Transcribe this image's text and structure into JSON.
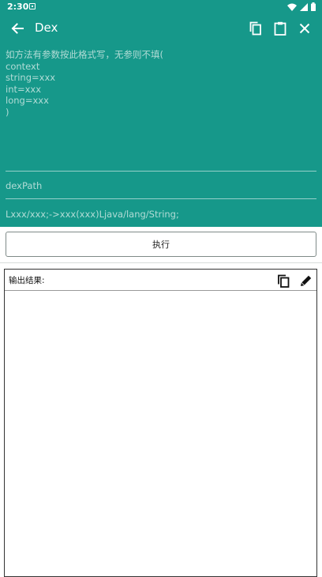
{
  "status_bar": {
    "time": "2:30"
  },
  "app_bar": {
    "title": "Dex"
  },
  "form": {
    "params_placeholder": "如方法有参数按此格式写，无参则不填(\ncontext\nstring=xxx\nint=xxx\nlong=xxx\n)",
    "dexpath_placeholder": "dexPath",
    "method_placeholder": "Lxxx/xxx;->xxx(xxx)Ljava/lang/String;"
  },
  "execute_button": {
    "label": "执行"
  },
  "output": {
    "label": "输出结果:",
    "content": ""
  },
  "colors": {
    "primary": "#16988a",
    "on_primary": "#ffffff",
    "output_border": "#333333"
  },
  "icons": [
    "back-arrow-icon",
    "copy-icon",
    "clipboard-icon",
    "close-icon",
    "pencil-icon",
    "wifi-icon",
    "signal-icon",
    "battery-icon"
  ]
}
